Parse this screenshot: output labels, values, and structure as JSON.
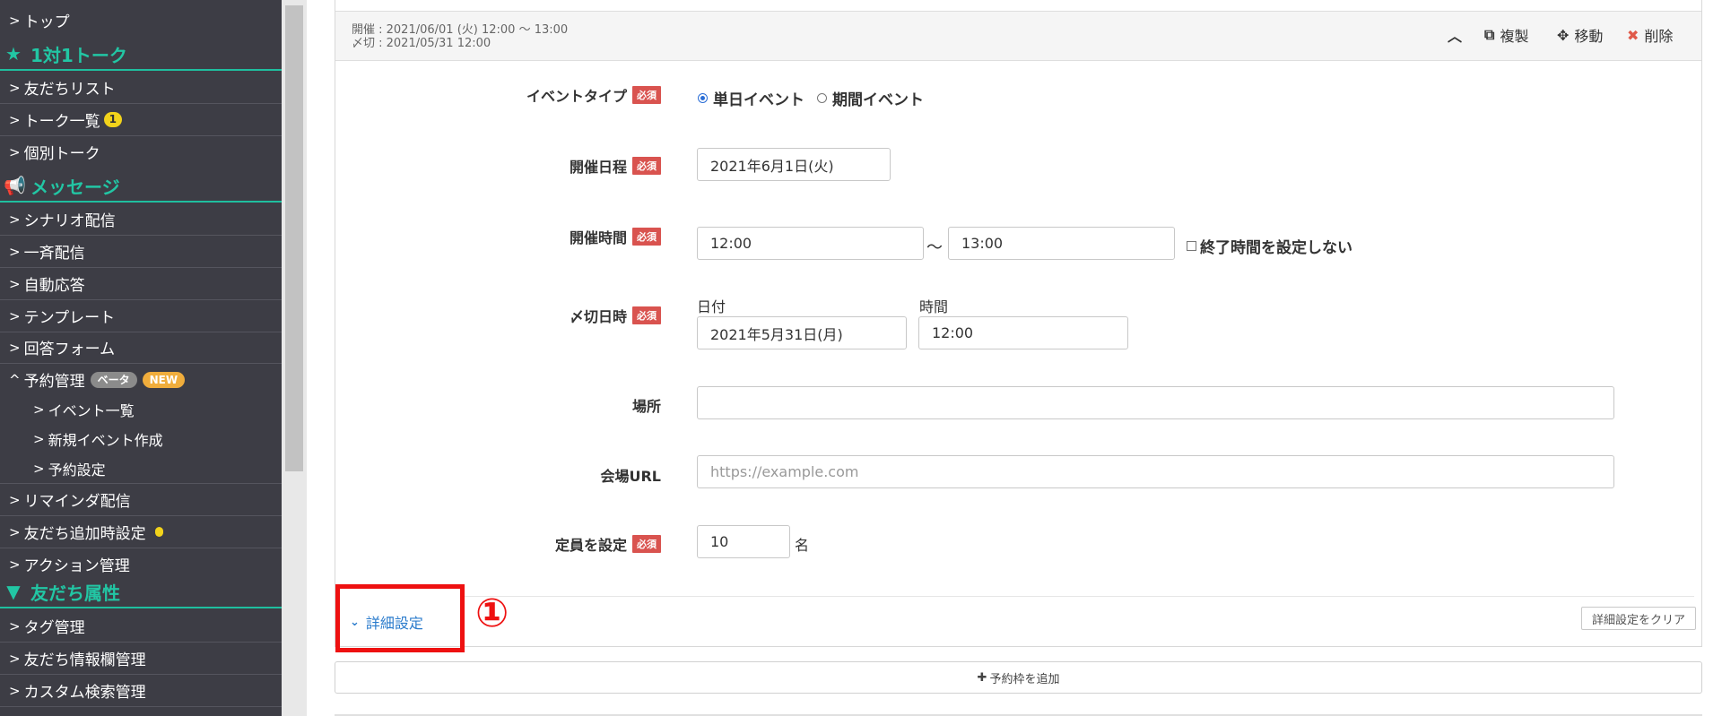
{
  "sidebar": {
    "top_link": "トップ",
    "sections": [
      {
        "title": "1対1トーク",
        "icon": "star-icon",
        "items": [
          {
            "label": "友だちリスト"
          },
          {
            "label": "トーク一覧",
            "badge": "1"
          },
          {
            "label": "個別トーク"
          }
        ]
      },
      {
        "title": "メッセージ",
        "icon": "megaphone-icon",
        "items": [
          {
            "label": "シナリオ配信"
          },
          {
            "label": "一斉配信"
          },
          {
            "label": "自動応答"
          },
          {
            "label": "テンプレート"
          },
          {
            "label": "回答フォーム"
          },
          {
            "label": "予約管理",
            "badge_beta": "ベータ",
            "badge_new": "NEW",
            "expanded": true,
            "sub": [
              "イベント一覧",
              "新規イベント作成",
              "予約設定"
            ]
          },
          {
            "label": "リマインダ配信"
          },
          {
            "label": "友だち追加時設定"
          },
          {
            "label": "アクション管理"
          }
        ]
      },
      {
        "title": "友だち属性",
        "icon": "filter-icon",
        "items": [
          {
            "label": "タグ管理"
          },
          {
            "label": "友だち情報欄管理"
          },
          {
            "label": "カスタム検索管理"
          }
        ]
      }
    ]
  },
  "card": {
    "meta_date": "開催 : 2021/06/01 (火) 12:00 ～ 13:00",
    "meta_deadline": "〆切 : 2021/05/31 12:00",
    "actions": {
      "copy": "複製",
      "move": "移動",
      "delete": "削除"
    },
    "required_label": "必須",
    "event_type": {
      "label": "イベントタイプ",
      "option1": "単日イベント",
      "option2": "期間イベント",
      "selected": "単日イベント"
    },
    "date": {
      "label": "開催日程",
      "value": "2021年6月1日(火)"
    },
    "time": {
      "label": "開催時間",
      "start": "12:00",
      "tilde": "～",
      "end": "13:00",
      "no_end": "終了時間を設定しない"
    },
    "deadline": {
      "label": "〆切日時",
      "date_label": "日付",
      "time_label": "時間",
      "date_value": "2021年5月31日(月)",
      "time_value": "12:00"
    },
    "place": {
      "label": "場所",
      "value": ""
    },
    "url": {
      "label": "会場URL",
      "placeholder": "https://example.com"
    },
    "capacity": {
      "label": "定員を設定",
      "value": "10",
      "unit": "名"
    },
    "detail_toggle": "詳細設定",
    "clear_detail": "詳細設定をクリア",
    "annotation_number": "①"
  },
  "add_slot": "予約枠を追加",
  "colors": {
    "sidebar_bg": "#3d3d45",
    "accent_teal": "#22c6a4",
    "required_red": "#d9534f",
    "link_blue": "#2a7bcc",
    "highlight_red": "#ee1111"
  }
}
